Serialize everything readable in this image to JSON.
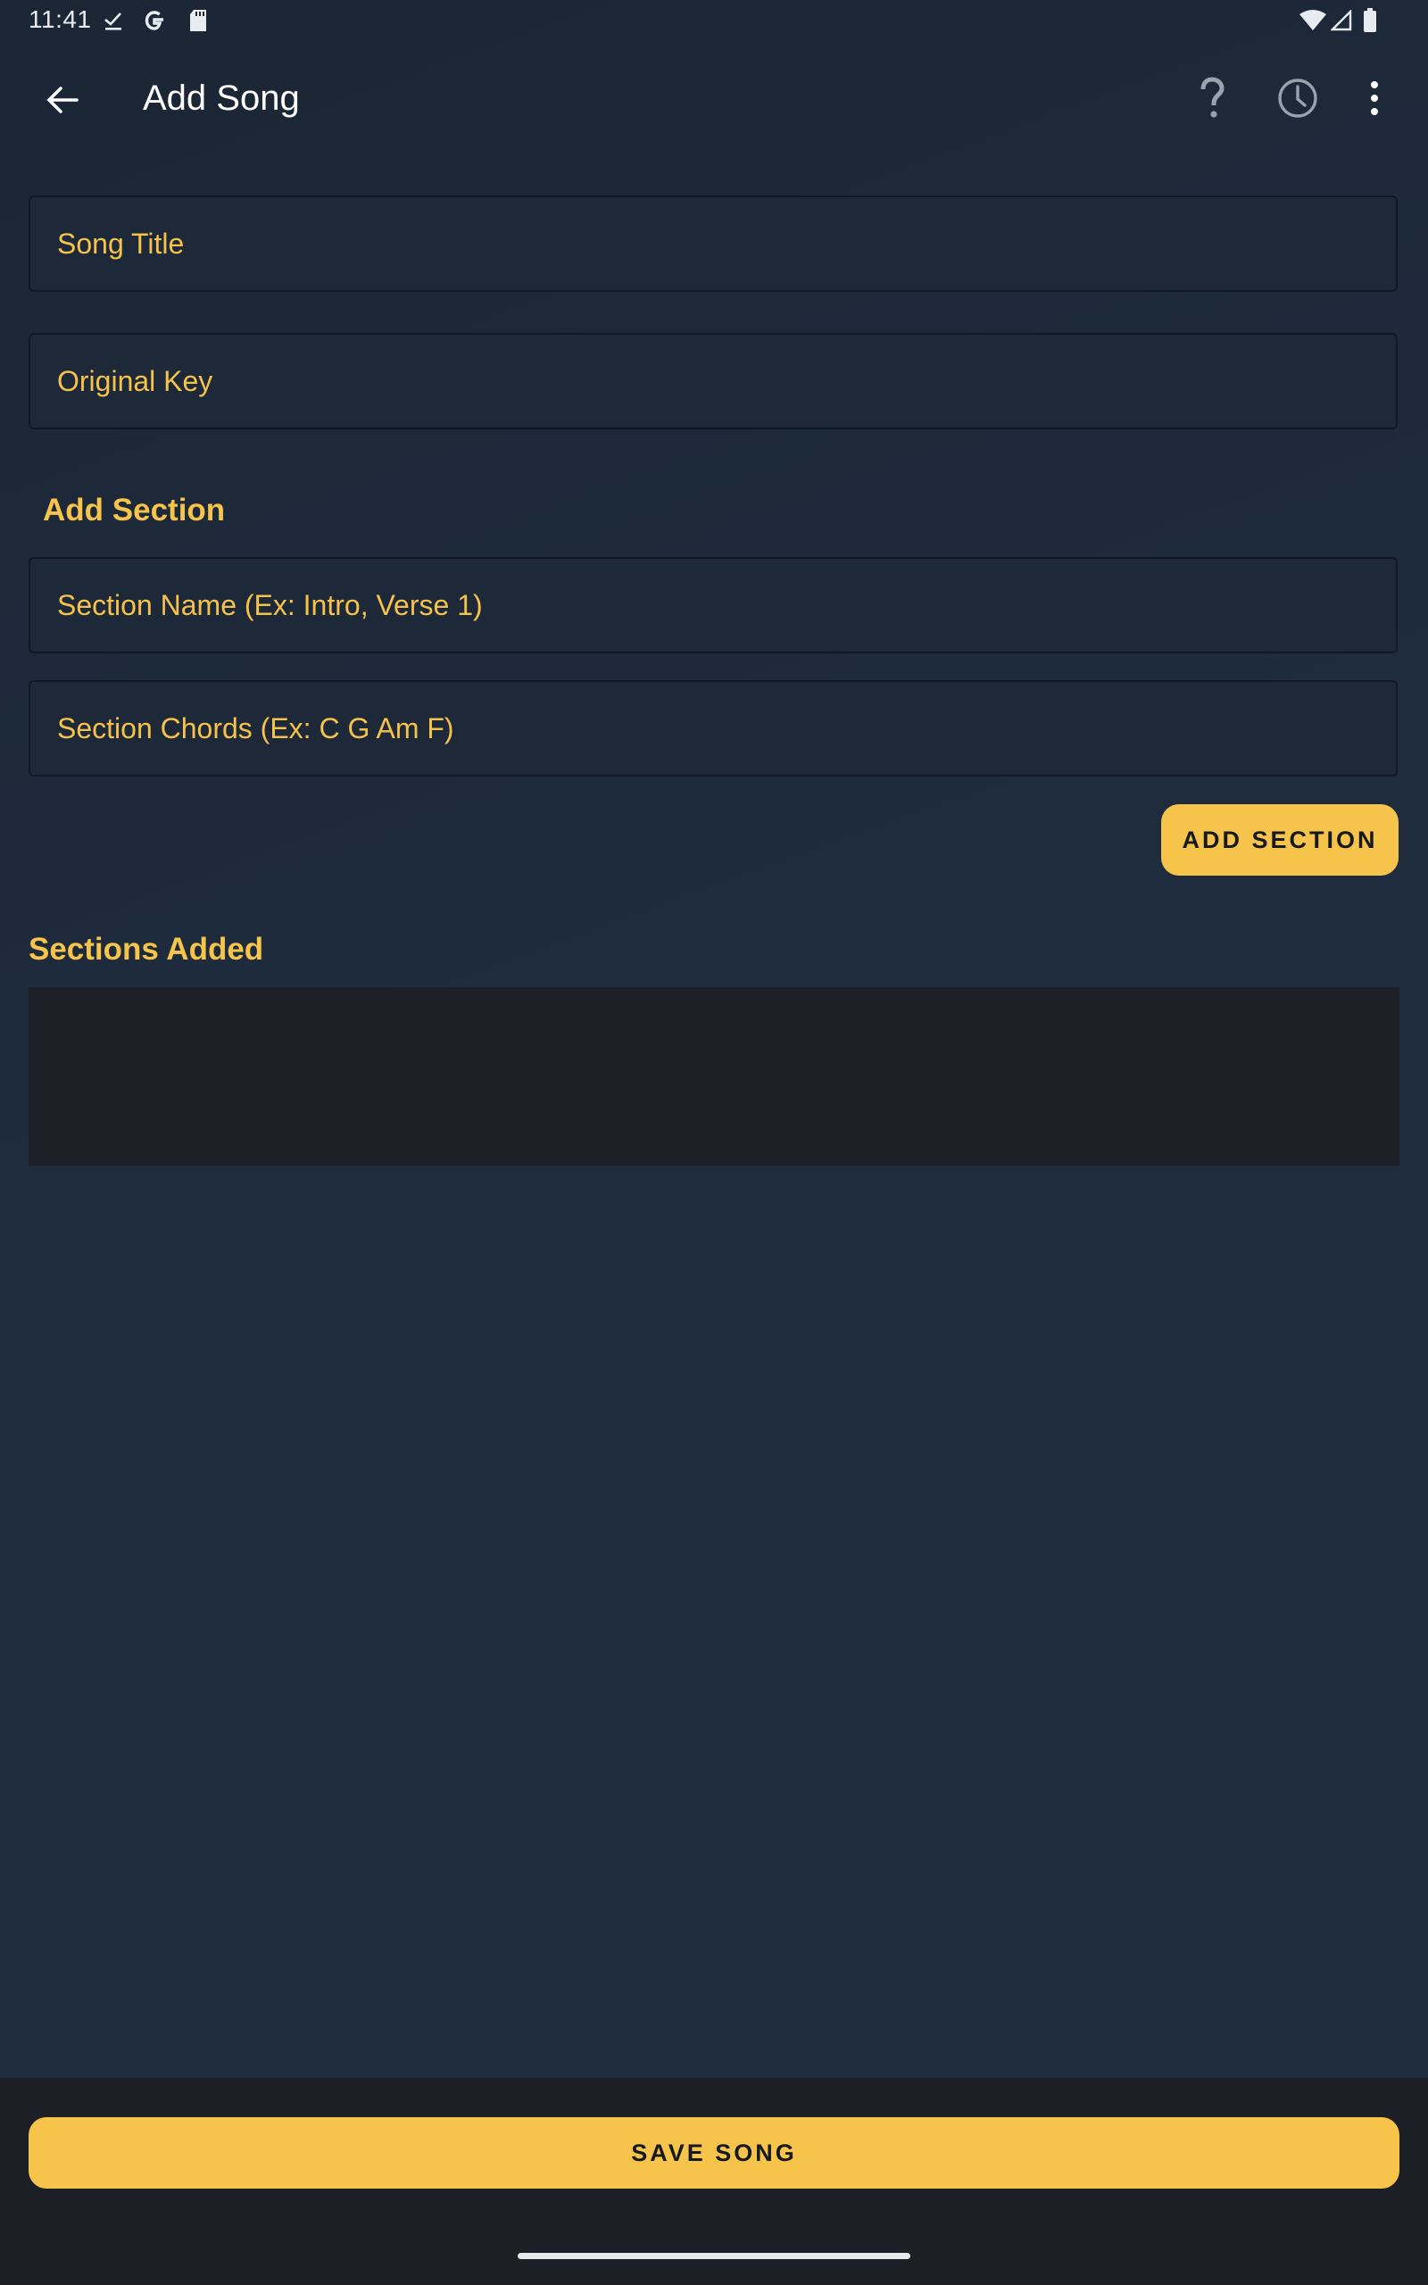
{
  "status_bar": {
    "time": "11:41",
    "icons": [
      "download-done-icon",
      "google-icon",
      "sd-card-icon",
      "wifi-icon",
      "cell-signal-icon",
      "battery-icon"
    ]
  },
  "app_bar": {
    "title": "Add Song",
    "icons": [
      "back-arrow-icon",
      "help-icon",
      "history-icon",
      "more-vert-icon"
    ]
  },
  "form": {
    "song_title_placeholder": "Song Title",
    "original_key_placeholder": "Original Key"
  },
  "add_section": {
    "heading": "Add Section",
    "name_placeholder": "Section Name (Ex: Intro, Verse 1)",
    "chords_placeholder": "Section Chords (Ex: C G Am F)",
    "button_label": "ADD SECTION"
  },
  "sections_added": {
    "heading": "Sections Added",
    "items": []
  },
  "footer": {
    "save_label": "SAVE SONG"
  },
  "colors": {
    "accent": "#f6c44b",
    "background": "#1f2b3c",
    "bottom_bar": "#1c1f25",
    "list_background": "#1d2026"
  }
}
